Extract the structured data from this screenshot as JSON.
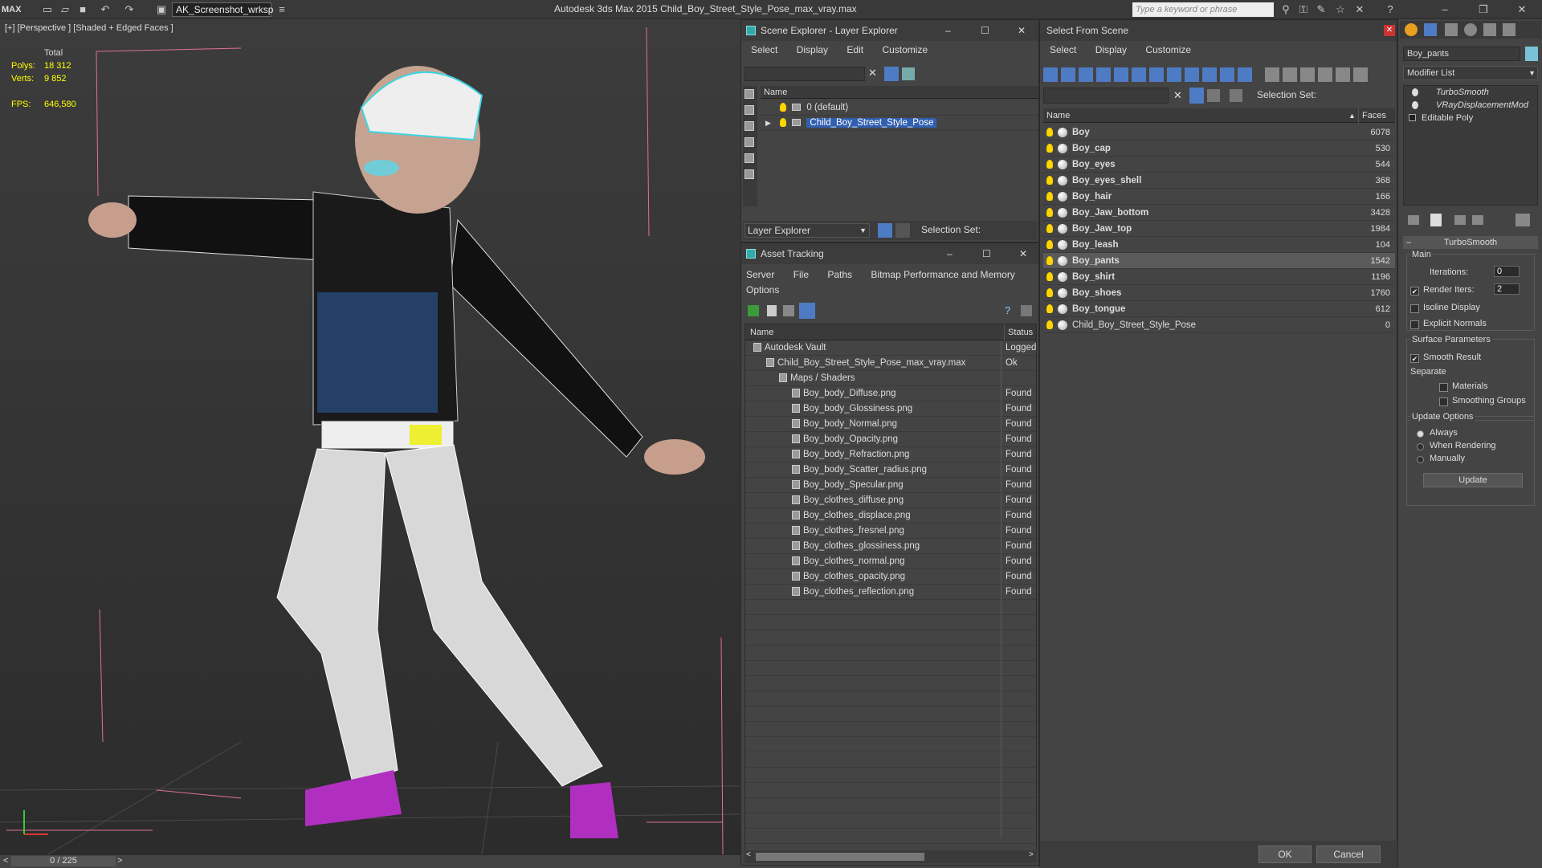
{
  "app": {
    "title": "Autodesk 3ds Max  2015    Child_Boy_Street_Style_Pose_max_vray.max",
    "logo": "MAX",
    "workspace": "AK_Screenshot_wrksp",
    "search_placeholder": "Type a keyword or phrase"
  },
  "viewport": {
    "label": "[+] [Perspective ] [Shaded + Edged Faces ]",
    "stats": {
      "total_label": "Total",
      "polys_label": "Polys:",
      "polys": "18 312",
      "verts_label": "Verts:",
      "verts": "9 852",
      "fps_label": "FPS:",
      "fps": "646,580"
    },
    "timeline": "0 / 225"
  },
  "scene_explorer": {
    "title": "Scene Explorer - Layer Explorer",
    "menu": [
      "Select",
      "Display",
      "Edit",
      "Customize"
    ],
    "col_name": "Name",
    "layers": [
      "0 (default)",
      "Child_Boy_Street_Style_Pose"
    ],
    "footer_dropdown": "Layer Explorer",
    "selection_set": "Selection Set:"
  },
  "asset_tracking": {
    "title": "Asset Tracking",
    "menu": [
      "Server",
      "File",
      "Paths",
      "Bitmap Performance and Memory",
      "Options"
    ],
    "cols": {
      "name": "Name",
      "status": "Status"
    },
    "rows": [
      {
        "name": "Autodesk Vault",
        "status": "Logged",
        "indent": 1
      },
      {
        "name": "Child_Boy_Street_Style_Pose_max_vray.max",
        "status": "Ok",
        "indent": 2
      },
      {
        "name": "Maps / Shaders",
        "status": "",
        "indent": 3
      },
      {
        "name": "Boy_body_Diffuse.png",
        "status": "Found",
        "indent": 4
      },
      {
        "name": "Boy_body_Glossiness.png",
        "status": "Found",
        "indent": 4
      },
      {
        "name": "Boy_body_Normal.png",
        "status": "Found",
        "indent": 4
      },
      {
        "name": "Boy_body_Opacity.png",
        "status": "Found",
        "indent": 4
      },
      {
        "name": "Boy_body_Refraction.png",
        "status": "Found",
        "indent": 4
      },
      {
        "name": "Boy_body_Scatter_radius.png",
        "status": "Found",
        "indent": 4
      },
      {
        "name": "Boy_body_Specular.png",
        "status": "Found",
        "indent": 4
      },
      {
        "name": "Boy_clothes_diffuse.png",
        "status": "Found",
        "indent": 4
      },
      {
        "name": "Boy_clothes_displace.png",
        "status": "Found",
        "indent": 4
      },
      {
        "name": "Boy_clothes_fresnel.png",
        "status": "Found",
        "indent": 4
      },
      {
        "name": "Boy_clothes_glossiness.png",
        "status": "Found",
        "indent": 4
      },
      {
        "name": "Boy_clothes_normal.png",
        "status": "Found",
        "indent": 4
      },
      {
        "name": "Boy_clothes_opacity.png",
        "status": "Found",
        "indent": 4
      },
      {
        "name": "Boy_clothes_reflection.png",
        "status": "Found",
        "indent": 4
      }
    ]
  },
  "select_from_scene": {
    "title": "Select From Scene",
    "menu": [
      "Select",
      "Display",
      "Customize"
    ],
    "selection_set": "Selection Set:",
    "cols": {
      "name": "Name",
      "faces": "Faces"
    },
    "objects": [
      {
        "name": "Boy",
        "faces": "6078"
      },
      {
        "name": "Boy_cap",
        "faces": "530"
      },
      {
        "name": "Boy_eyes",
        "faces": "544"
      },
      {
        "name": "Boy_eyes_shell",
        "faces": "368"
      },
      {
        "name": "Boy_hair",
        "faces": "166"
      },
      {
        "name": "Boy_Jaw_bottom",
        "faces": "3428"
      },
      {
        "name": "Boy_Jaw_top",
        "faces": "1984"
      },
      {
        "name": "Boy_leash",
        "faces": "104"
      },
      {
        "name": "Boy_pants",
        "faces": "1542"
      },
      {
        "name": "Boy_shirt",
        "faces": "1196"
      },
      {
        "name": "Boy_shoes",
        "faces": "1760"
      },
      {
        "name": "Boy_tongue",
        "faces": "612"
      },
      {
        "name": "Child_Boy_Street_Style_Pose",
        "faces": "0"
      }
    ],
    "ok": "OK",
    "cancel": "Cancel"
  },
  "command_panel": {
    "object_name": "Boy_pants",
    "modifier_list": "Modifier List",
    "stack": [
      "TurboSmooth",
      "VRayDisplacementMod",
      "Editable Poly"
    ],
    "rollout_title": "TurboSmooth",
    "main_label": "Main",
    "iterations_label": "Iterations:",
    "iterations": "0",
    "render_iters_label": "Render Iters:",
    "render_iters": "2",
    "isoline": "Isoline Display",
    "explicit_normals": "Explicit Normals",
    "surface_params": "Surface Parameters",
    "smooth_result": "Smooth Result",
    "separate": "Separate",
    "materials": "Materials",
    "smoothing_groups": "Smoothing Groups",
    "update_options": "Update Options",
    "always": "Always",
    "when_rendering": "When Rendering",
    "manually": "Manually",
    "update_button": "Update"
  }
}
